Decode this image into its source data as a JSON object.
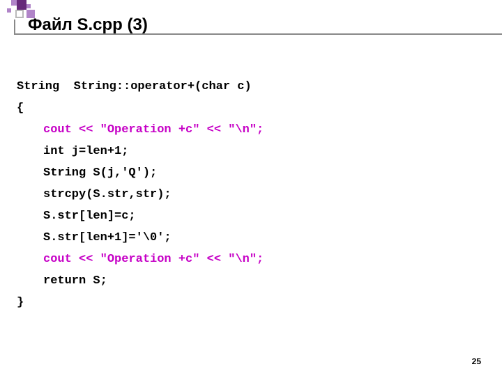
{
  "title": "Файл S.cpp (3)",
  "code": {
    "l1": "String  String::operator+(char c)",
    "l2": "{",
    "l3": "cout << \"Operation +c\" << \"\\n\";",
    "l4": "int j=len+1;",
    "l5": "String S(j,'Q');",
    "l6": "strcpy(S.str,str);",
    "l7": "S.str[len]=c;",
    "l8": "S.str[len+1]='\\0';",
    "l9": "cout << \"Operation +c\" << \"\\n\";",
    "l10": "return S;",
    "l11": "}"
  },
  "pagenum": "25"
}
